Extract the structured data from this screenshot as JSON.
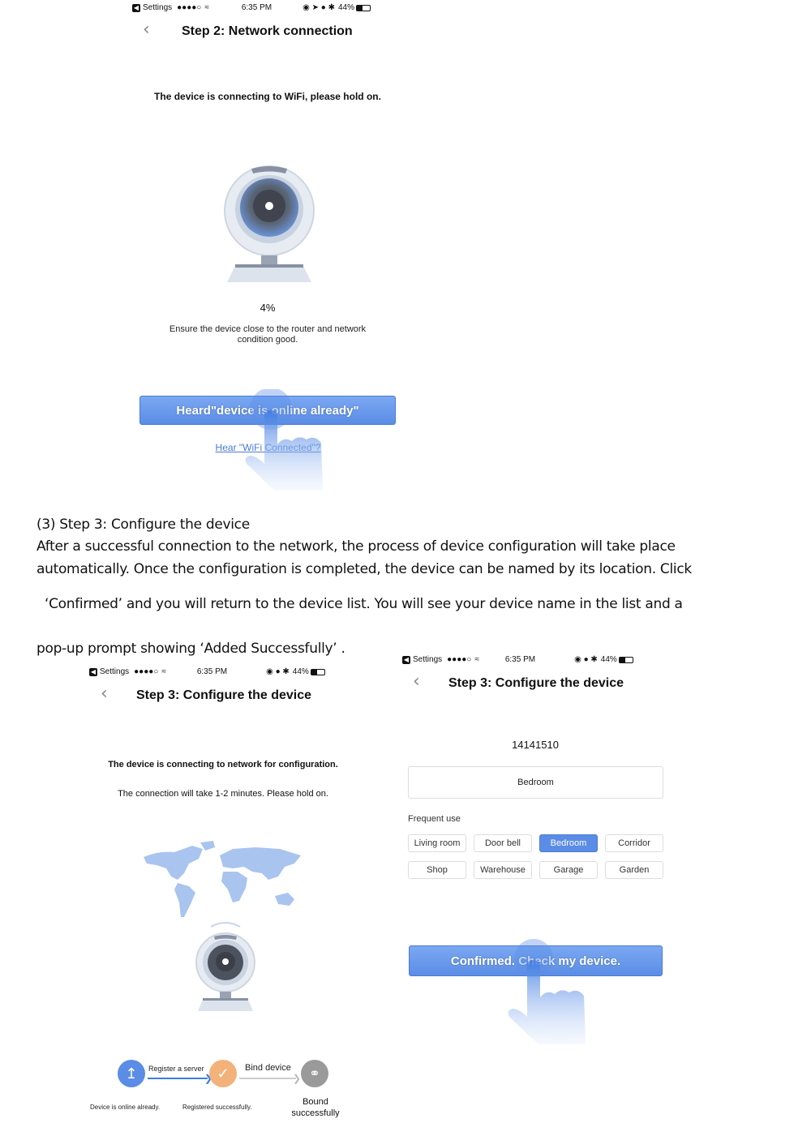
{
  "screen1": {
    "status": {
      "app": "Settings",
      "signal": "●●●●○",
      "time": "6:35 PM",
      "battery": "44%"
    },
    "nav_title": "Step 2: Network connection",
    "message": "The device is connecting to WiFi, please hold on.",
    "progress_text": "4%",
    "progress_value": 4,
    "hint": "Ensure the device close to the router and network condition good.",
    "primary_button": "Heard\"device is online already\"",
    "secondary_link": "Hear \"WiFi Connected\"?"
  },
  "document": {
    "heading": "(3) Step 3: Configure the device",
    "lines": [
      "After a successful connection to the network, the process of device configuration will take place",
      "automatically. Once the configuration is completed, the device can be named by its location. Click",
      "‘Confirmed’   and you will return to the device list. You will see your device name in the list and a",
      "pop-up prompt showing  ‘Added Successfully’  ."
    ]
  },
  "screen2": {
    "status": {
      "app": "Settings",
      "signal": "●●●●○",
      "time": "6:35 PM",
      "battery": "44%"
    },
    "nav_title": "Step 3: Configure the device",
    "message1": "The device is connecting to network for configuration.",
    "message2": "The connection will take 1-2 minutes. Please hold on.",
    "steps": [
      {
        "arrow_label": "Register a server",
        "caption": "Device is online already.",
        "state": "done",
        "color": "#5b8de6"
      },
      {
        "arrow_label": "Bind device",
        "caption": "Registered successfully.",
        "state": "current",
        "color": "#f3b27a"
      },
      {
        "arrow_label": "",
        "caption": "Bound successfully",
        "state": "pending",
        "color": "#9a9a9a"
      }
    ]
  },
  "screen3": {
    "status": {
      "app": "Settings",
      "signal": "●●●●○",
      "time": "6:35 PM",
      "battery": "44%"
    },
    "nav_title": "Step 3: Configure the device",
    "device_id": "14141510",
    "name_input_value": "Bedroom",
    "frequent_label": "Frequent use",
    "chips": [
      {
        "label": "Living room",
        "selected": false
      },
      {
        "label": "Door bell",
        "selected": false
      },
      {
        "label": "Bedroom",
        "selected": true
      },
      {
        "label": "Corridor",
        "selected": false
      },
      {
        "label": "Shop",
        "selected": false
      },
      {
        "label": "Warehouse",
        "selected": false
      },
      {
        "label": "Garage",
        "selected": false
      },
      {
        "label": "Garden",
        "selected": false
      }
    ],
    "confirm_button": "Confirmed. Check my device."
  },
  "colors": {
    "accent": "#5b8de6",
    "accent_dark": "#4a7bd6",
    "map": "#a9c4ef",
    "orange": "#f3b27a",
    "gray": "#9a9a9a"
  }
}
